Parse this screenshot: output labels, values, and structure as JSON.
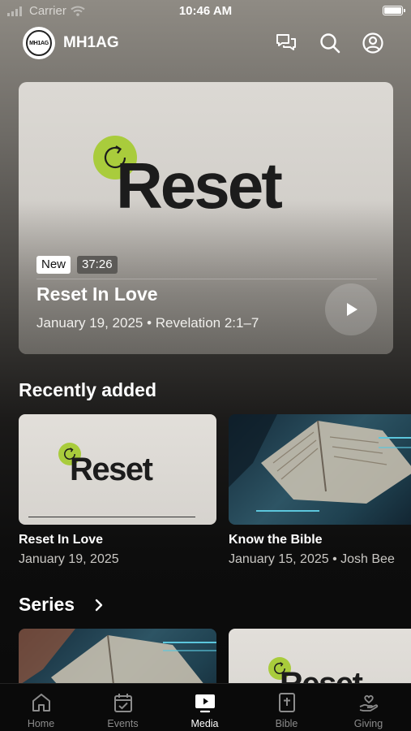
{
  "status_bar": {
    "carrier": "Carrier",
    "time": "10:46 AM"
  },
  "header": {
    "logo_text": "MH1AG",
    "title": "MH1AG"
  },
  "hero": {
    "artwork_text": "Reset",
    "badge_new": "New",
    "duration": "37:26",
    "title": "Reset In Love",
    "subtitle": "January 19, 2025 • Revelation 2:1–7"
  },
  "recently_added": {
    "heading": "Recently added",
    "items": [
      {
        "artwork_text": "Reset",
        "title": "Reset In Love",
        "subtitle": "January 19, 2025"
      },
      {
        "title": "Know the Bible",
        "subtitle": "January 15, 2025 • Josh Bee"
      }
    ]
  },
  "series": {
    "heading": "Series",
    "items": [
      {
        "artwork": "bible"
      },
      {
        "artwork_text": "Reset"
      }
    ]
  },
  "tabs": [
    {
      "label": "Home",
      "icon": "home-icon",
      "active": false
    },
    {
      "label": "Events",
      "icon": "calendar-check-icon",
      "active": false
    },
    {
      "label": "Media",
      "icon": "tv-play-icon",
      "active": true
    },
    {
      "label": "Bible",
      "icon": "bible-icon",
      "active": false
    },
    {
      "label": "Giving",
      "icon": "heart-hand-icon",
      "active": false
    }
  ],
  "colors": {
    "accent": "#a9cc3c",
    "tab_active": "#ffffff",
    "tab_inactive": "#8c8c8c"
  }
}
